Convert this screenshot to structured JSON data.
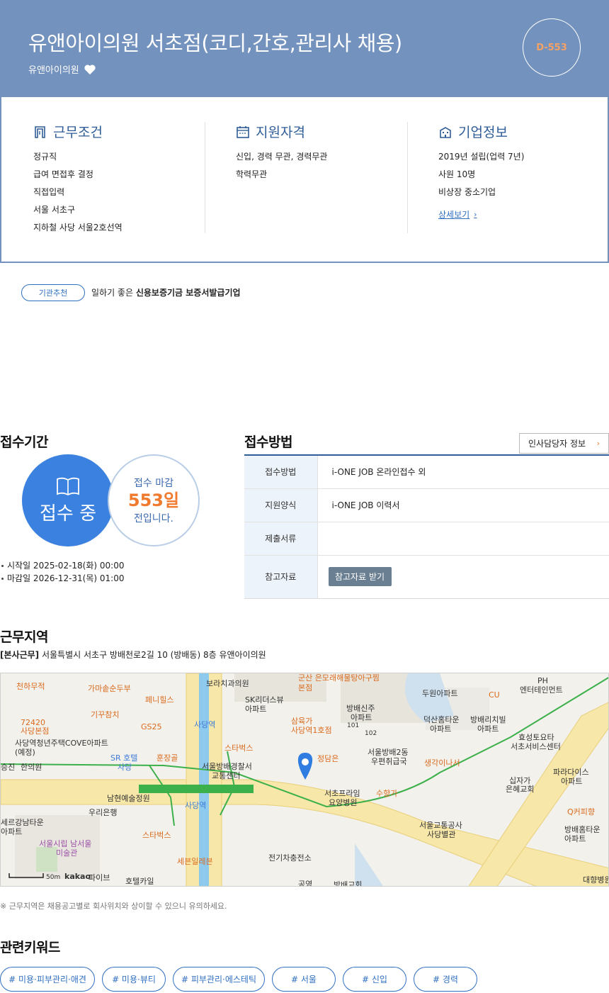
{
  "header": {
    "title": "유앤아이의원 서초점(코디,간호,관리사 채용)",
    "company": "유앤아이의원",
    "dday": "D-553"
  },
  "colors": {
    "header_bg": "#7392bd",
    "accent_blue": "#3b82e0",
    "accent_orange": "#f07a2e"
  },
  "work_conditions": {
    "title": "근무조건",
    "items": [
      "정규직",
      "급여 면접후 결정",
      "직접입력",
      "서울 서초구",
      "지하철 사당 서울2호선역"
    ]
  },
  "qualifications": {
    "title": "지원자격",
    "items": [
      "신입, 경력 무관, 경력무관",
      "학력무관"
    ]
  },
  "company_info": {
    "title": "기업정보",
    "items": [
      "2019년 설립(업력 7년)",
      "사원 10명",
      "비상장 중소기업"
    ],
    "more_label": "상세보기"
  },
  "recommendation": {
    "badge": "기관추천",
    "prefix": "일하기 좋은",
    "bold": "신용보증기금 보증서발급기업"
  },
  "period": {
    "title": "접수기간",
    "status": "접수 중",
    "deadline_line1": "접수 마감",
    "deadline_days": "553일",
    "deadline_line3": "전입니다.",
    "start": "시작일 2025-02-18(화) 00:00",
    "end": "마감일 2026-12-31(목) 01:00"
  },
  "method": {
    "title": "접수방법",
    "hr_button": "인사담당자 정보",
    "rows": [
      {
        "label": "접수방법",
        "value": "i-ONE JOB 온라인접수 외"
      },
      {
        "label": "지원양식",
        "value": "i-ONE JOB 이력서"
      },
      {
        "label": "제출서류",
        "value": ""
      },
      {
        "label": "참고자료",
        "value": ""
      }
    ],
    "file_button": "참고자료 받기"
  },
  "location": {
    "title": "근무지역",
    "address_tag": "[본사근무]",
    "address": "서울특별시 서초구 방배천로2길 10 (방배동) 8층 유앤아이의원",
    "note": "※ 근무지역은 채용공고별로 회사위치와 상이할 수 있으니 유의하세요.",
    "map": {
      "scale": "50m",
      "brand": "kakao",
      "labels": {
        "l1": "천하무적",
        "l2": "가마솥순두부",
        "l3": "보라치과의원",
        "l4": "군산 은모래해물탕아구찜",
        "l5": "본점",
        "l6": "두원아파트",
        "l7": "PH",
        "l8": "엔터테인먼트",
        "l9": "페니힐스",
        "l10": "SK리더스뷰",
        "l11": "아파트",
        "l12": "CU",
        "l13": "기꾸참치",
        "l14": "72420",
        "l15": "사당본점",
        "l16": "GS25",
        "l17": "사당역",
        "l18": "삼육가",
        "l19": "사당역1호점",
        "l20": "방배신주",
        "l21": "아파트",
        "l22": "덕산홈타운",
        "l23": "아파트",
        "l24": "방배리치빌",
        "l25": "아파트",
        "l26": "효성토요타",
        "l27": "서초서비스센터",
        "l28": "사당역청년주택COVE아파트",
        "l29": "(예정)",
        "l30": "SR 호텔",
        "l31": "사당",
        "l32": "훈장골",
        "l33": "스타벅스",
        "l34": "서울방배경찰서",
        "l35": "교통센터",
        "l36": "정담은",
        "l37": "서울방배2동",
        "l38": "우편취급국",
        "l39": "생각이나서",
        "l40": "파라다이스",
        "l41": "아파트",
        "l42": "십자가",
        "l43": "은혜교회",
        "l44": "세르강남타운",
        "l45": "아파트",
        "l46": "한의원",
        "l47": "남현예술정원",
        "l48": "우리은행",
        "l49": "사당역",
        "l50": "서초프라임",
        "l51": "요양병원",
        "l52": "수향가",
        "l53": "Q커피향",
        "l54": "서울교통공사",
        "l55": "사당별관",
        "l56": "방배홈타운",
        "l57": "아파트",
        "l58": "서울시립 남서울",
        "l59": "미술관",
        "l60": "스타벅스",
        "l61": "세븐일레븐",
        "l62": "전기차충전소",
        "l63": "파이브",
        "l64": "호텔카일",
        "l65": "공영",
        "l66": "방배교회",
        "l67": "대향병원",
        "l68": "101",
        "l69": "102",
        "l70": "승진"
      }
    }
  },
  "keywords": {
    "title": "관련키워드",
    "items": [
      "# 미용·피부관리·애견",
      "# 미용·뷰티",
      "# 피부관리·에스테틱",
      "# 서울",
      "# 신입",
      "# 경력"
    ]
  }
}
